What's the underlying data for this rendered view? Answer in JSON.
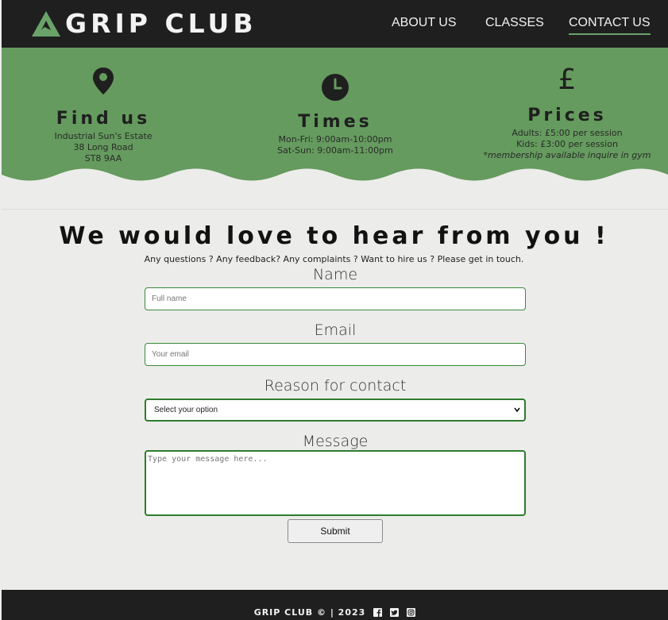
{
  "header": {
    "brand": "GRIP CLUB",
    "nav": [
      {
        "label": "ABOUT US",
        "active": false
      },
      {
        "label": "CLASSES",
        "active": false
      },
      {
        "label": "CONTACT US",
        "active": true
      }
    ]
  },
  "info": {
    "find_us": {
      "icon": "map-pin-icon",
      "title": "Find us",
      "lines": [
        "Industrial Sun's Estate",
        "38 Long Road",
        "ST8 9AA"
      ]
    },
    "times": {
      "icon": "clock-icon",
      "title": "Times",
      "lines": [
        "Mon-Fri: 9:00am-10:00pm",
        "Sat-Sun: 9:00am-11:00pm"
      ]
    },
    "prices": {
      "icon": "pound-icon",
      "symbol": "£",
      "title": "Prices",
      "lines": [
        "Adults: £5:00 per session",
        "Kids: £3:00 per session",
        "*membership available inquire in gym"
      ]
    }
  },
  "contact": {
    "heading": "We would love to hear from you !",
    "subheading": "Any questions ? Any feedback? Any complaints ? Want to hire us ? Please get in touch.",
    "name_label": "Name",
    "name_placeholder": "Full name",
    "email_label": "Email",
    "email_placeholder": "Your email",
    "reason_label": "Reason for contact",
    "reason_selected": "Select your option",
    "message_label": "Message",
    "message_placeholder": "Type your message here...",
    "submit_label": "Submit"
  },
  "footer": {
    "text": "GRIP CLUB © | 2023",
    "social_icons": [
      "facebook-icon",
      "twitter-icon",
      "instagram-icon"
    ]
  },
  "colors": {
    "header_bg": "#1f1f1f",
    "band_green": "#659b5e",
    "accent_green": "#2e7d2e",
    "page_bg": "#ececea"
  }
}
